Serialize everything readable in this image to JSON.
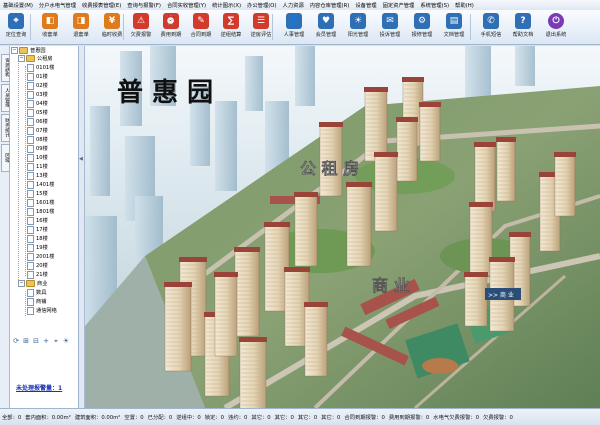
{
  "menu": [
    "基础设置(M)",
    "分户水电气管理",
    "收费报表管理(E)",
    "查询与报警(F)",
    "合同实收管理(Y)",
    "统计图示(X)",
    "办公管理(O)",
    "人力资源",
    "内容仓库管理(R)",
    "设备管理",
    "固定资产管理",
    "系统管理(S)",
    "帮助(H)"
  ],
  "toolbar": {
    "items": [
      "定位查询",
      "收套单",
      "退套单",
      "临时收费",
      "欠费报警",
      "费用到期",
      "合同到期",
      "逆组结算",
      "逆房评估",
      "人事管理",
      "会员管理",
      "阳光管理",
      "投诉管理",
      "报修管理",
      "文档管理",
      "手机短信",
      "帮助文档",
      "退出系统"
    ]
  },
  "vtabs": [
    "资源结构",
    "人员管理",
    "财务统计",
    "区域"
  ],
  "tree": {
    "root": "普惠园",
    "group1": "公租房",
    "buildings": [
      "0101楼",
      "01楼",
      "02楼",
      "03楼",
      "04楼",
      "05楼",
      "06楼",
      "07楼",
      "08楼",
      "09楼",
      "10楼",
      "11楼",
      "13楼",
      "1401楼",
      "15楼",
      "1601楼",
      "1801楼",
      "16楼",
      "17楼",
      "18楼",
      "19楼",
      "2001楼",
      "20楼",
      "21楼"
    ],
    "group2": "商业",
    "shops": [
      "数具",
      "商铺",
      "通信网络"
    ]
  },
  "icons": [
    "refresh-icon",
    "expand-all-icon",
    "collapse-all-icon",
    "add-icon",
    "locate-icon",
    "bulb-icon"
  ],
  "warning_link": "未处理报警量：1",
  "scene": {
    "title": "普 惠 园",
    "label_housing": "公 租 房",
    "label_commerce": "商 业",
    "sign": ">> 商  业"
  },
  "status": [
    "全部：0",
    "套内面积：0.00m²",
    "建筑面积：0.00m²",
    "空置：0",
    "已分配：0",
    "逆组中：0",
    "锁定：0",
    "违约：0",
    "其它：0",
    "其它：0",
    "其它：0",
    "其它：0",
    "合同到期报警：0",
    "费用到期报警：0",
    "水电气欠费报警：0",
    "欠费报警：0"
  ],
  "colors": {
    "accent": "#2f6fb6",
    "link": "#1a33b3",
    "toolbar_bg": "#e4edf7"
  }
}
